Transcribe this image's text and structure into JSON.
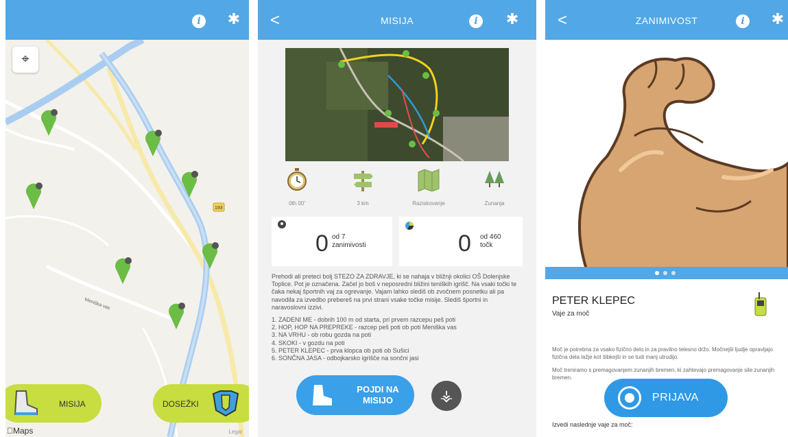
{
  "screen_map": {
    "nav": {
      "info_icon": "info-icon",
      "settings_icon": "gear-icon"
    },
    "locate_icon": "crosshair-icon",
    "mission_button": {
      "label": "MISIJA",
      "icon": "hiking-boot-icon"
    },
    "achievements_button": {
      "label": "DOSEŽKI",
      "icon": "badge-icon"
    },
    "maps_label": "Maps",
    "road_label": "Meniška vas",
    "route_marker": "193",
    "legal_label": "Legal",
    "colors": {
      "pin": "#6bbd45",
      "water": "#a9cdf0",
      "pill": "#c8dd3f",
      "bar": "#52a7e6"
    }
  },
  "screen_mission": {
    "nav": {
      "back_label": "<",
      "title": "MISIJA",
      "info_icon": "info-icon",
      "settings_icon": "gear-icon"
    },
    "stats": [
      {
        "icon": "stopwatch-icon",
        "label": "0th 00'"
      },
      {
        "icon": "signpost-icon",
        "label": "3 km"
      },
      {
        "icon": "map-icon",
        "label": "Raziskovanje"
      },
      {
        "icon": "trees-icon",
        "label": "Zunanja"
      }
    ],
    "poi_counter": {
      "value": "0",
      "of_line1": "od 7",
      "of_line2": "zanimivosti"
    },
    "points_counter": {
      "value": "0",
      "of_line1": "od 460",
      "of_line2": "točk"
    },
    "description": "Prehodi ali preteci bolj STEZO ZA ZDRAVJE, ki se nahaja v bližnji okolici OŠ Dolenjske Toplice. Pot je označena. Začel jo boš v neposredni bližini teniških igrišč. Na vsaki točki te čaka nekaj športnih vaj za ogrevanje. Vajam lahko slediš ob zvočnem posnetku ali pa navodila za izvedbo prebereš na prvi strani vsake točke misije. Slediš športni in naravoslovni izzivi.",
    "list": [
      "1. ZADENI ME - dobrih 100 m od starta, pri prvem razcepu peš poti",
      "2. HOP, HOP NA PREPREKE - razcep peš poti ob poti Meniška vas",
      "3. NA VRHU - ob robu gozda na poti",
      "4. SKOKI - v gozdu na poti",
      "5. PETER KLEPEC - prva klopca ob poti ob Sušici",
      "6. SONČNA JASA - odbojkarsko igrišče na sončni jasi"
    ],
    "go_button": {
      "line1": "POJDI NA",
      "line2": "MISIJO",
      "icon": "hiking-boot-icon"
    },
    "share_icon": "share-icon"
  },
  "screen_interest": {
    "nav": {
      "back_label": "<",
      "title": "ZANIMIVOST",
      "info_icon": "info-icon",
      "settings_icon": "gear-icon"
    },
    "image_icon": "flexed-arm-icon",
    "name": "PETER KLEPEC",
    "subtitle": "Vaje za moč",
    "paragraph1": "Moč je potrebna za vsako fizično delo in za pravilno telesno držo. Močnejši ljudje opravljajo fizična dela lažje kot šibkejši in se tudi manj utrudijo.",
    "paragraph2": "Moč treniramo s premagovanjem zunanjih bremen, ki zahtevajo premagovanje sile zunanjih bremen.",
    "exercises_heading": "Izvedi naslednje vaje za moč:",
    "signin_button": {
      "label": "PRIJAVA",
      "icon": "record-icon"
    },
    "colors": {
      "skin": "#d6a572",
      "outline": "#5a3a22",
      "button": "#2f99e5"
    }
  }
}
